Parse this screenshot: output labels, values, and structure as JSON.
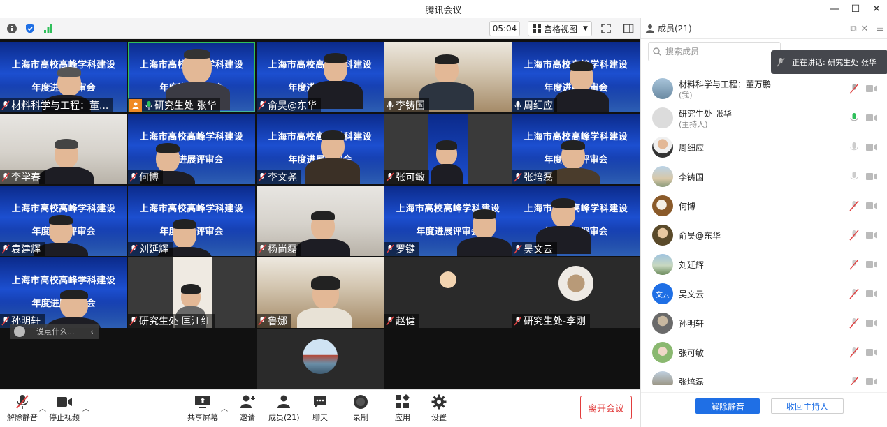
{
  "window": {
    "title": "腾讯会议",
    "min": "—",
    "max": "☐",
    "close": "✕"
  },
  "toolbar": {
    "timer": "05:04",
    "view_mode": "宫格视图"
  },
  "banner": {
    "line1": "上海市高校高峰学科建设",
    "line2": "年度进展评审会"
  },
  "tiles": [
    {
      "name": "材料科学与工程：董..."
    },
    {
      "name": "研究生处  张华"
    },
    {
      "name": "俞昊@东华"
    },
    {
      "name": "李铸国"
    },
    {
      "name": "周细应"
    },
    {
      "name": "李学春"
    },
    {
      "name": "何博"
    },
    {
      "name": "李文尧"
    },
    {
      "name": "张可敏"
    },
    {
      "name": "张培磊"
    },
    {
      "name": "袁建辉"
    },
    {
      "name": "刘延辉"
    },
    {
      "name": "杨尚磊"
    },
    {
      "name": "罗键"
    },
    {
      "name": "吴文云"
    },
    {
      "name": "孙明轩"
    },
    {
      "name": "研究生处 匡江红"
    },
    {
      "name": "鲁娜"
    },
    {
      "name": "赵健"
    },
    {
      "name": "研究生处-李刚"
    }
  ],
  "chat": {
    "placeholder": "说点什么..."
  },
  "controls": {
    "unmute": "解除静音",
    "stop_video": "停止视频",
    "share": "共享屏幕",
    "invite": "邀请",
    "members": "成员(21)",
    "chat": "聊天",
    "record": "录制",
    "apps": "应用",
    "settings": "设置",
    "leave": "离开会议"
  },
  "panel": {
    "title": "成员(21)",
    "search_placeholder": "搜索成员",
    "speaking": "正在讲话: 研究生处  张华",
    "members": [
      {
        "name": "材料科学与工程：董万鹏",
        "sub": "(我)",
        "mic": "muted"
      },
      {
        "name": "研究生处  张华",
        "sub": "(主持人)",
        "mic": "active"
      },
      {
        "name": "周细应",
        "sub": "",
        "mic": "on"
      },
      {
        "name": "李铸国",
        "sub": "",
        "mic": "on"
      },
      {
        "name": "何博",
        "sub": "",
        "mic": "muted"
      },
      {
        "name": "俞昊@东华",
        "sub": "",
        "mic": "muted"
      },
      {
        "name": "刘延辉",
        "sub": "",
        "mic": "muted"
      },
      {
        "name": "吴文云",
        "sub": "",
        "mic": "muted",
        "avatar_text": "文云"
      },
      {
        "name": "孙明轩",
        "sub": "",
        "mic": "muted"
      },
      {
        "name": "张可敏",
        "sub": "",
        "mic": "muted"
      },
      {
        "name": "张培磊",
        "sub": "",
        "mic": "muted"
      }
    ],
    "unmute_all": "解除静音",
    "reclaim_host": "收回主持人"
  },
  "colors": {
    "accent": "#1f6fe5",
    "danger": "#e23d3d",
    "speaking_green": "#2fbf5b",
    "muted_red": "#e04040"
  }
}
